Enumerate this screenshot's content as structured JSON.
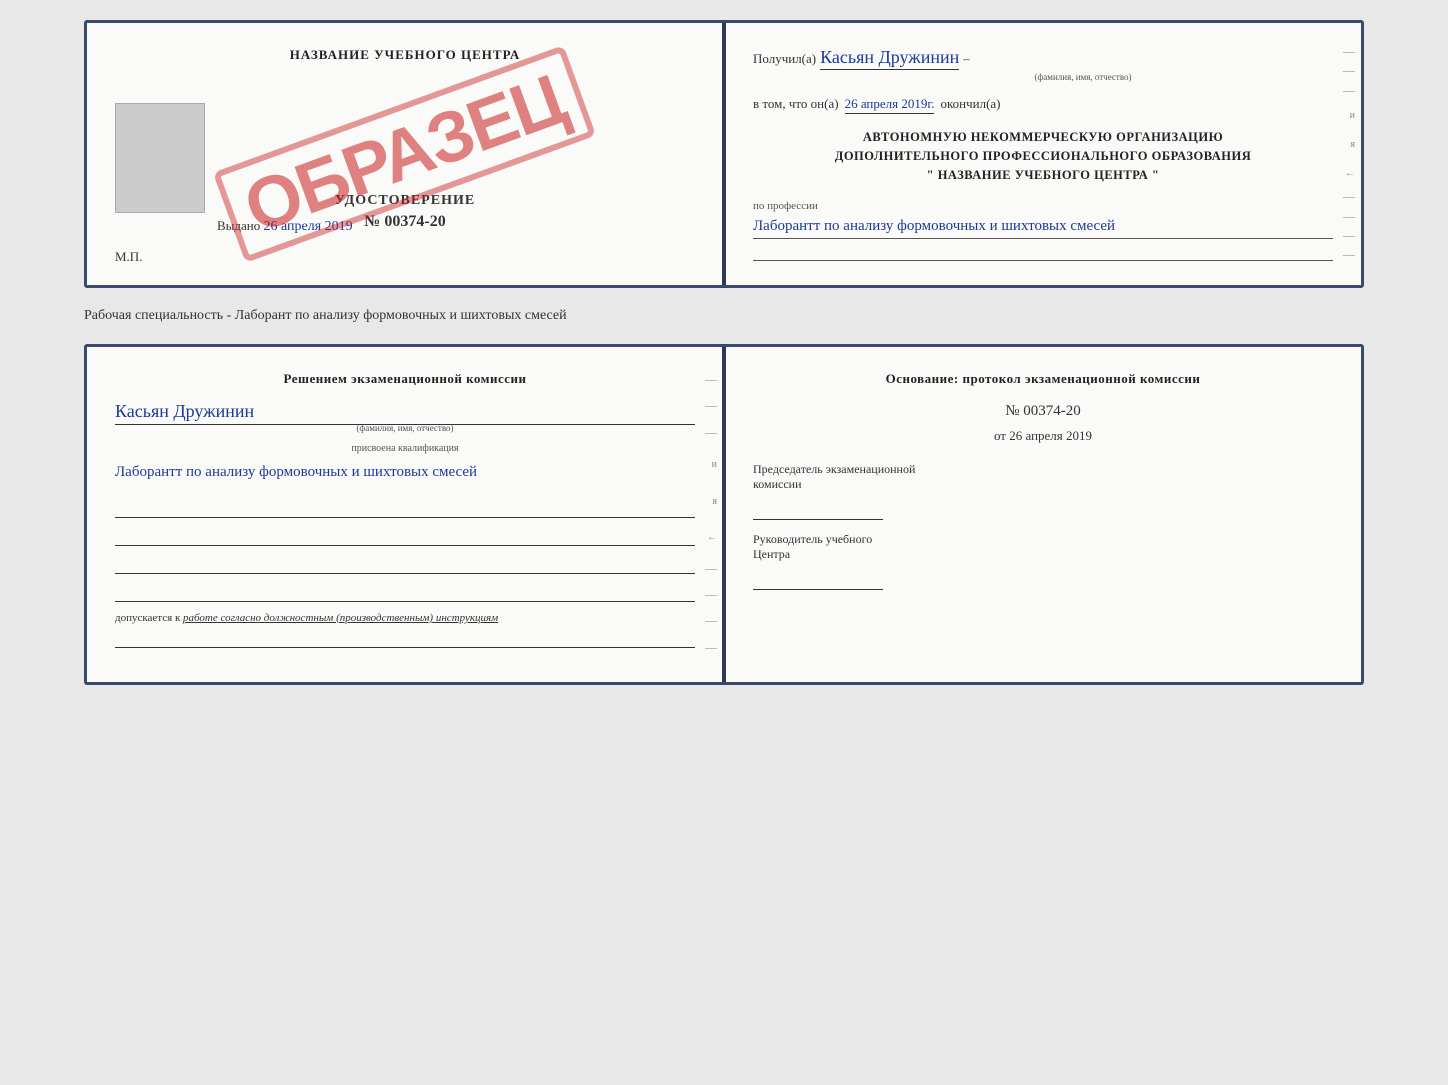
{
  "top_cert": {
    "left": {
      "title": "НАЗВАНИЕ УЧЕБНОГО ЦЕНТРА",
      "stamp": "ОБРАЗЕЦ",
      "udostoverenie_label": "УДОСТОВЕРЕНИЕ",
      "number": "№ 00374-20",
      "vydano_prefix": "Выдано",
      "vydano_date": "26 апреля 2019",
      "mp": "М.П."
    },
    "right": {
      "poluchil": "Получил(а)",
      "fio": "Касьян Дружинин",
      "fio_hint": "(фамилия, имя, отчество)",
      "vtom_prefix": "в том, что он(а)",
      "vtom_date": "26 апреля 2019г.",
      "okonchil": "окончил(а)",
      "org_line1": "АВТОНОМНУЮ НЕКОММЕРЧЕСКУЮ ОРГАНИЗАЦИЮ",
      "org_line2": "ДОПОЛНИТЕЛЬНОГО ПРОФЕССИОНАЛЬНОГО ОБРАЗОВАНИЯ",
      "org_line3": "\" НАЗВАНИЕ УЧЕБНОГО ЦЕНТРА \"",
      "prof_label": "по профессии",
      "prof_value": "Лаборантт по анализу формовочных и шихтовых смесей"
    }
  },
  "specialty_label": "Рабочая специальность - Лаборант по анализу формовочных и шихтовых смесей",
  "bottom_cert": {
    "left": {
      "resheniem": "Решением экзаменационной комиссии",
      "fio": "Касьян Дружинин",
      "fio_hint": "(фамилия, имя, отчество)",
      "prisvoena_label": "присвоена квалификация",
      "kvali": "Лаборантт по анализу формовочных и шихтовых смесей",
      "dopuskaetsya_prefix": "допускается к",
      "dopuskaetsya_text": "работе согласно должностным (производственным) инструкциям"
    },
    "right": {
      "osnovanie": "Основание: протокол экзаменационной комиссии",
      "number": "№ 00374-20",
      "ot_prefix": "от",
      "ot_date": "26 апреля 2019",
      "predsedatel_line1": "Председатель экзаменационной",
      "predsedatel_line2": "комиссии",
      "rukovoditel_line1": "Руководитель учебного",
      "rukovoditel_line2": "Центра"
    }
  },
  "edge_symbols": {
    "and": "и",
    "ya": "я",
    "arrow": "←"
  }
}
